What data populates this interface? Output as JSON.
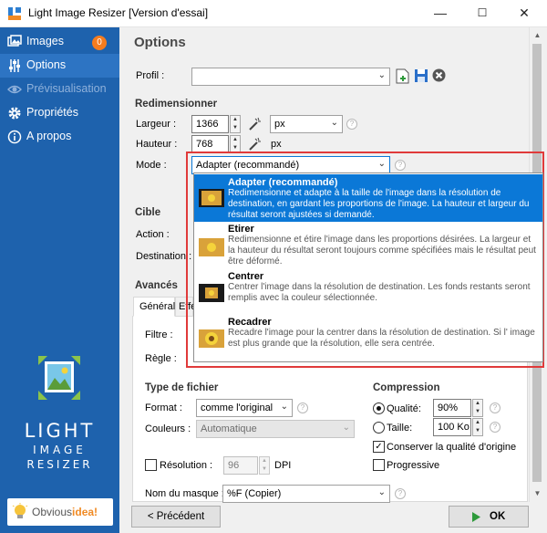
{
  "window": {
    "title": "Light Image Resizer  [Version d'essai]",
    "min": "—",
    "max": "☐",
    "close": "✕"
  },
  "sidebar": {
    "items": [
      {
        "label": "Images",
        "badge": "0"
      },
      {
        "label": "Options"
      },
      {
        "label": "Prévisualisation"
      },
      {
        "label": "Propriétés"
      },
      {
        "label": "A propos"
      }
    ],
    "logo": {
      "line1": "LIGHT",
      "line2": "IMAGE",
      "line3": "RESIZER"
    },
    "brand": {
      "text": "Obvious",
      "highlight": "idea!"
    }
  },
  "main": {
    "title": "Options",
    "profile_label": "Profil :",
    "profile_value": "",
    "resize_section": "Redimensionner",
    "width_label": "Largeur :",
    "width_value": "1366",
    "height_label": "Hauteur :",
    "height_value": "768",
    "unit_select": "px",
    "unit_static": "px",
    "mode_label": "Mode :",
    "mode_value": "Adapter (recommandé)",
    "target_section": "Cible",
    "action_label": "Action :",
    "destination_label": "Destination :",
    "advanced_section": "Avancés",
    "tabs": [
      "Général",
      "Effe"
    ],
    "filter_label": "Filtre :",
    "rule_label": "Règle :",
    "filetype_section": "Type de fichier",
    "format_label": "Format :",
    "format_value": "comme l'original",
    "colors_label": "Couleurs :",
    "colors_value": "Automatique",
    "resolution_label": "Résolution :",
    "resolution_value": "96",
    "resolution_unit": "DPI",
    "mask_label": "Nom du masque :",
    "mask_value": "%F (Copier)",
    "compression_section": "Compression",
    "quality_label": "Qualité:",
    "quality_value": "90%",
    "size_label": "Taille:",
    "size_value": "100 Ko",
    "keep_quality_label": "Conserver la qualité d'origine",
    "progressive_label": "Progressive",
    "back_button": "< Précédent",
    "ok_button": "OK"
  },
  "mode_dropdown": {
    "options": [
      {
        "title": "Adapter (recommandé)",
        "description": "Redimensionne et adapte à la taille de l'image dans la résolution de destination, en gardant les proportions de l'image. La hauteur et largeur du résultat seront ajustées si demandé."
      },
      {
        "title": "Etirer",
        "description": "Redimensionne et étire l'image dans les proportions désirées. La largeur et la hauteur du résultat seront toujours comme spécifiées mais le résultat peut être déformé."
      },
      {
        "title": "Centrer",
        "description": "Centrer l'image dans la résolution de destination. Les fonds restants seront remplis avec la couleur sélectionnée."
      },
      {
        "title": "Recadrer",
        "description": "Recadre l'image pour la centrer dans la résolution de destination. Si l' image est plus grande que la résolution, elle sera centrée."
      }
    ]
  },
  "colors": {
    "sidebar": "#1e62ad",
    "accent": "#0b78d7",
    "highlight_border": "#e03a3a",
    "badge": "#f57c1f"
  }
}
